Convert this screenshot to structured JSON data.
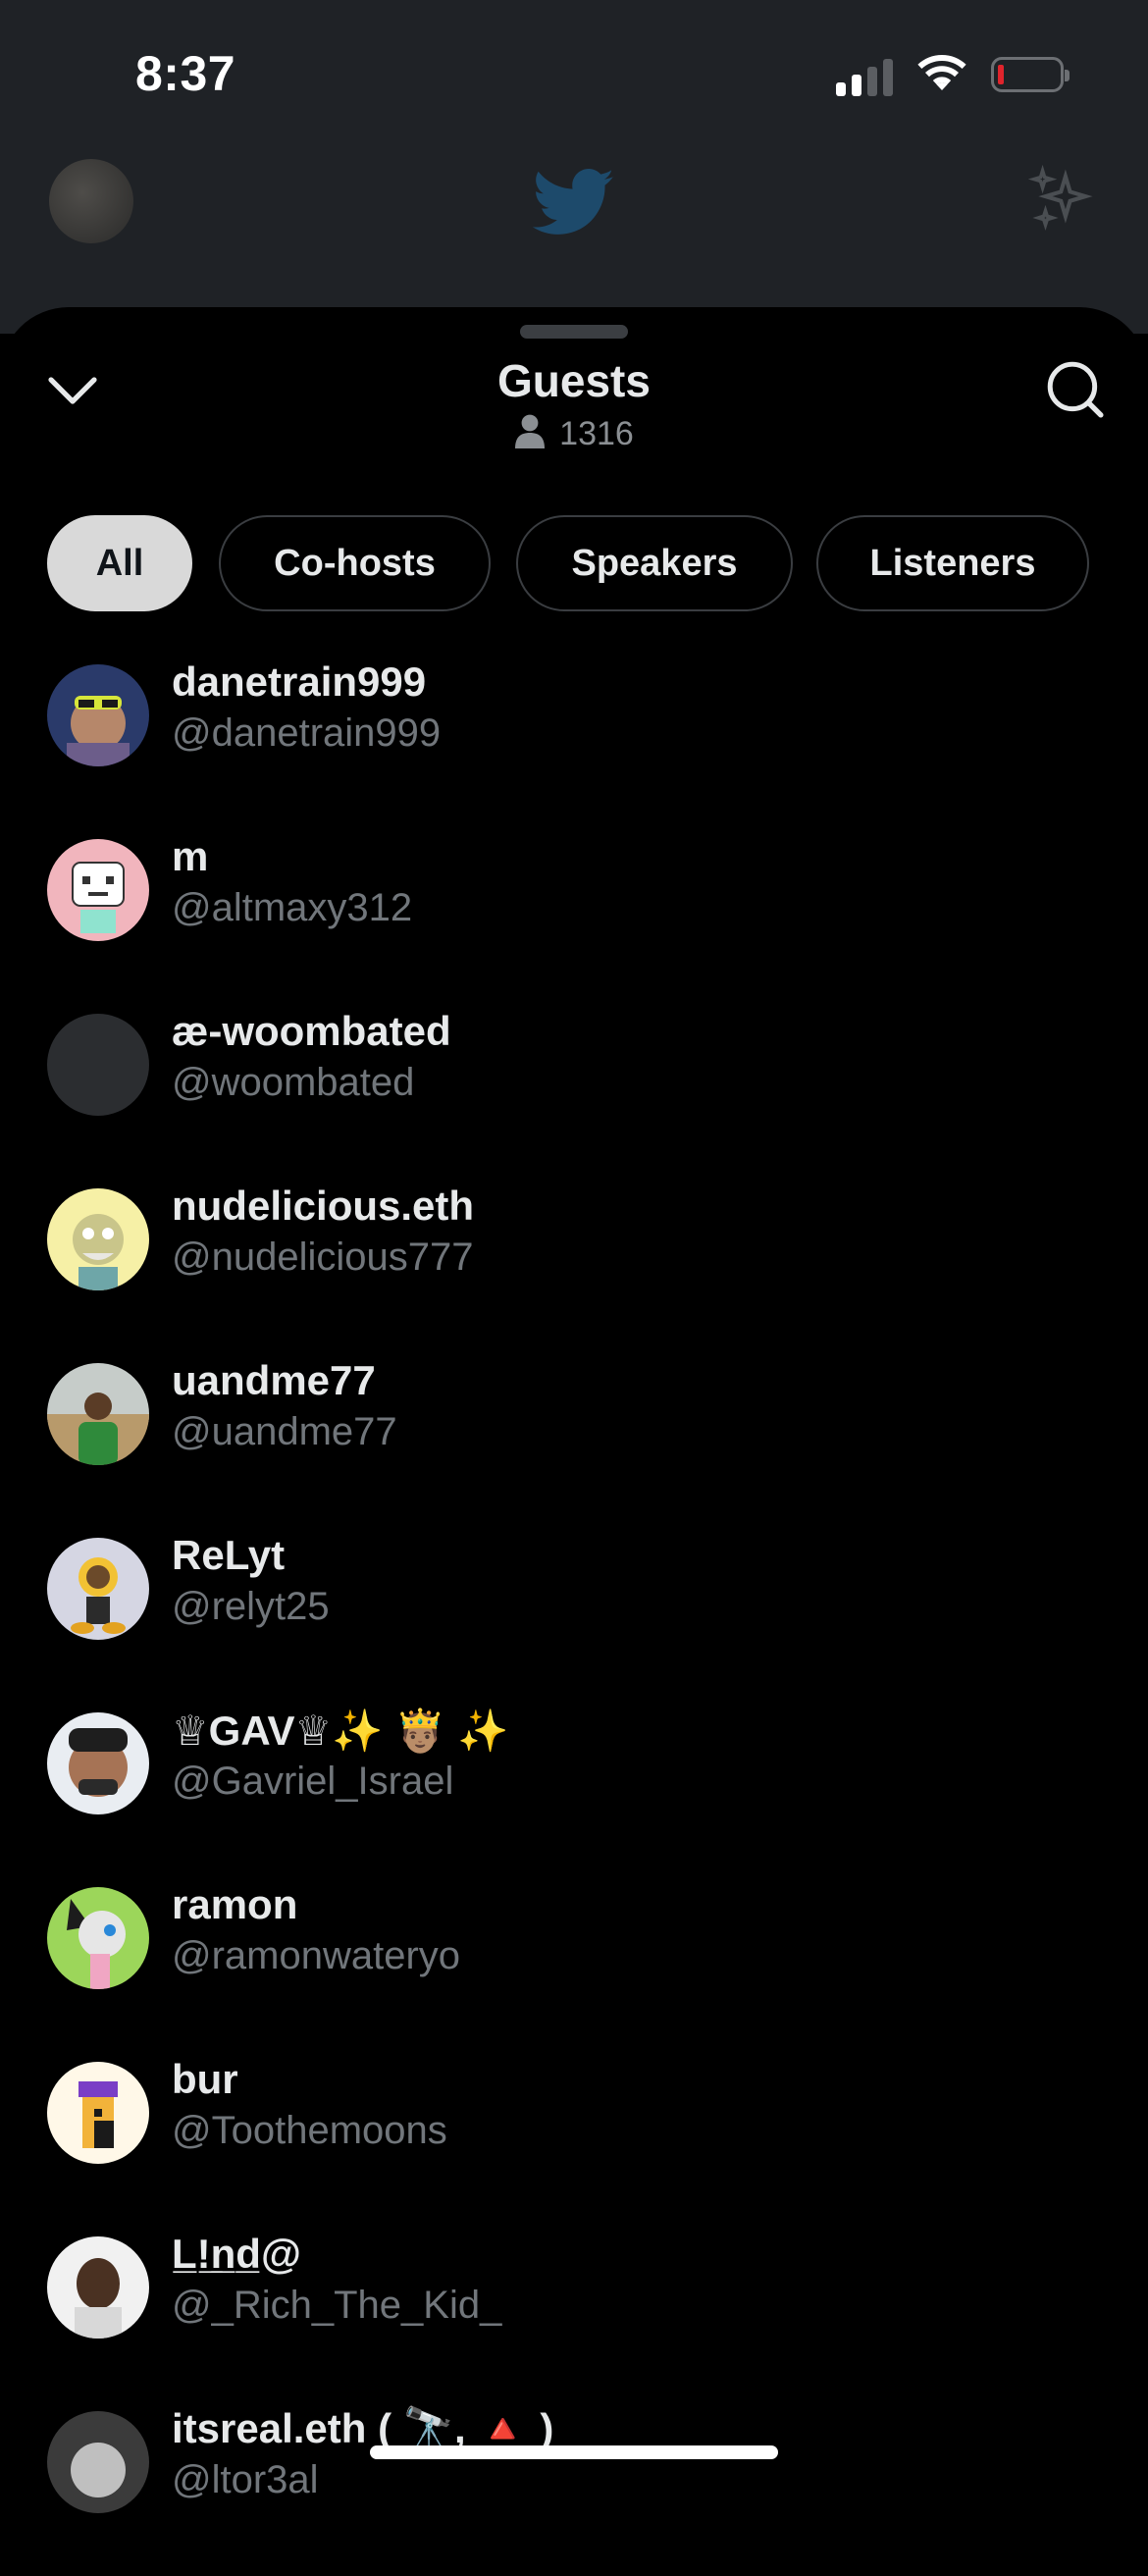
{
  "status_bar": {
    "time": "8:37"
  },
  "sheet": {
    "title": "Guests",
    "guest_count": "1316"
  },
  "filters": [
    {
      "label": "All",
      "active": true
    },
    {
      "label": "Co-hosts",
      "active": false
    },
    {
      "label": "Speakers",
      "active": false
    },
    {
      "label": "Listeners",
      "active": false
    }
  ],
  "guests": [
    {
      "name": "danetrain999",
      "handle": "@danetrain999"
    },
    {
      "name": "m",
      "handle": "@altmaxy312"
    },
    {
      "name": "æ-woombated",
      "handle": "@woombated"
    },
    {
      "name": "nudelicious.eth",
      "handle": "@nudelicious777"
    },
    {
      "name": "uandme77",
      "handle": "@uandme77"
    },
    {
      "name": "ReLyt",
      "handle": "@relyt25"
    },
    {
      "name": "♕GAV♕✨ 🤴🏽 ✨",
      "handle": "@Gavriel_Israel"
    },
    {
      "name": "ramon",
      "handle": "@ramonwateryo"
    },
    {
      "name": "bur",
      "handle": "@Toothemoons"
    },
    {
      "name": "L̲!̲n̲d̲@",
      "handle": "@_Rich_The_Kid_"
    },
    {
      "name": "itsreal.eth ( 🔭, 🔺 )",
      "handle": "@ltor3al"
    }
  ],
  "colors": {
    "accent_chip": "#d9d9d9",
    "handle_gray": "#71767b",
    "battery_low": "#e0242c"
  }
}
